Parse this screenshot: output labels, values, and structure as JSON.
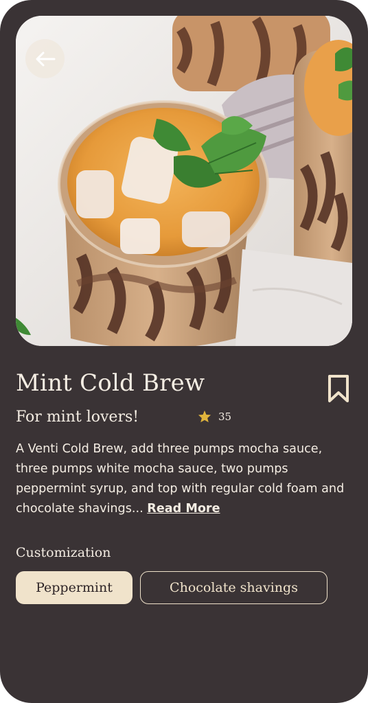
{
  "drink": {
    "title": "Mint Cold Brew",
    "subtitle": "For mint lovers!",
    "rating_count": "35",
    "description": "A Venti Cold Brew, add three pumps mocha sauce, three pumps white mocha sauce, two pumps peppermint syrup, and top with regular cold foam and chocolate shavings... ",
    "read_more": "Read More"
  },
  "customization": {
    "label": "Customization",
    "options": [
      "Peppermint",
      "Chocolate shavings"
    ]
  },
  "icons": {
    "back": "arrow-left-icon",
    "bookmark": "bookmark-icon",
    "rating": "star-icon"
  },
  "colors": {
    "background": "#3a3335",
    "text": "#f4ede3",
    "accent_chip": "#f0e3cb",
    "star": "#e0b43c"
  }
}
